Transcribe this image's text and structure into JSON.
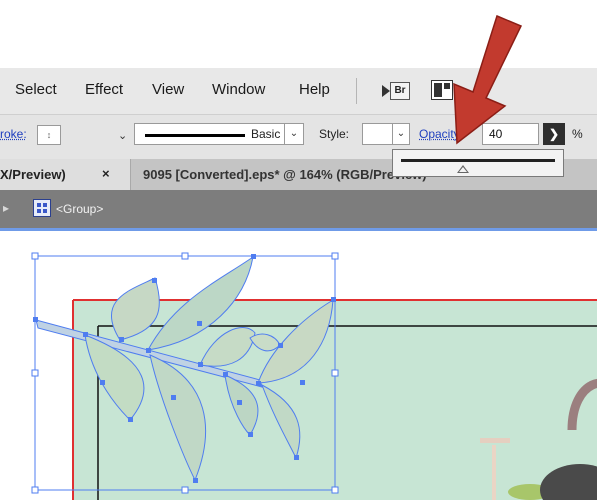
{
  "menubar": {
    "items": [
      {
        "label": "Select"
      },
      {
        "label": "Effect"
      },
      {
        "label": "View"
      },
      {
        "label": "Window"
      },
      {
        "label": "Help"
      }
    ],
    "bridge_label": "Br"
  },
  "controlbar": {
    "stroke_label": "roke:",
    "stroke_spinner_glyph": "↕",
    "stroke_style_label": "Basic",
    "style_label": "Style:",
    "opacity_label": "Opacity:",
    "opacity_value": "40",
    "opacity_arrow_glyph": "❯",
    "percent_label": "%"
  },
  "tabs": {
    "tab1_label": "X/Preview)",
    "tab1_close": "×",
    "tab2_label": "9095 [Converted].eps* @ 164% (RGB/Preview)"
  },
  "groupbar": {
    "back_arrow": "▸",
    "label": "<Group>"
  },
  "opacity_popup": {
    "slider_level": 0.4
  },
  "colors": {
    "annotation_arrow": "#c0392b",
    "selection_blue": "#4f7df0",
    "artboard_red": "#e03030",
    "canvas_fill": "#c7e5d4",
    "leaf_fill": "#bcd7c6"
  }
}
